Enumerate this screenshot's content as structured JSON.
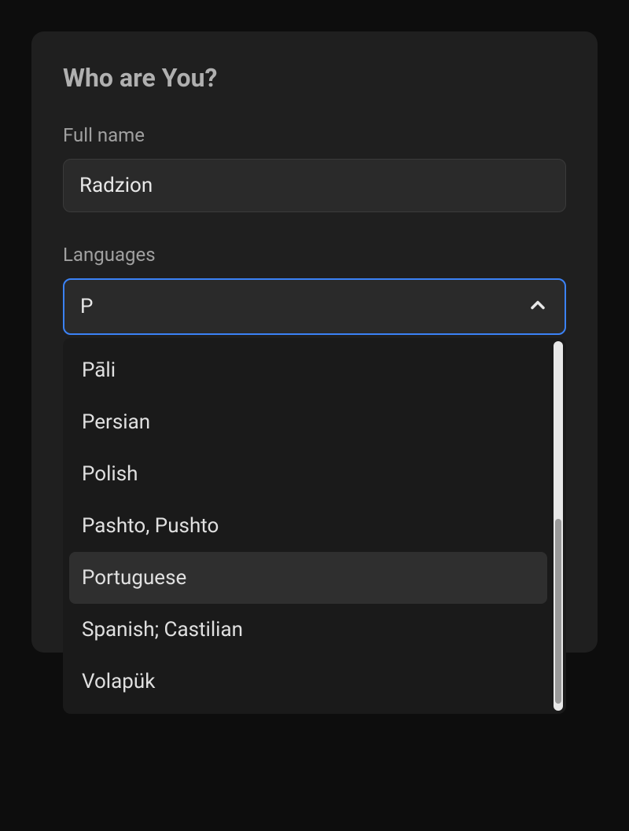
{
  "card": {
    "title": "Who are You?"
  },
  "fields": {
    "fullname": {
      "label": "Full name",
      "value": "Radzion"
    },
    "languages": {
      "label": "Languages",
      "query": "P",
      "options": [
        {
          "label": "Pāli",
          "highlighted": false
        },
        {
          "label": "Persian",
          "highlighted": false
        },
        {
          "label": "Polish",
          "highlighted": false
        },
        {
          "label": "Pashto, Pushto",
          "highlighted": false
        },
        {
          "label": "Portuguese",
          "highlighted": true
        },
        {
          "label": "Spanish; Castilian",
          "highlighted": false
        },
        {
          "label": "Volapük",
          "highlighted": false
        }
      ]
    }
  }
}
